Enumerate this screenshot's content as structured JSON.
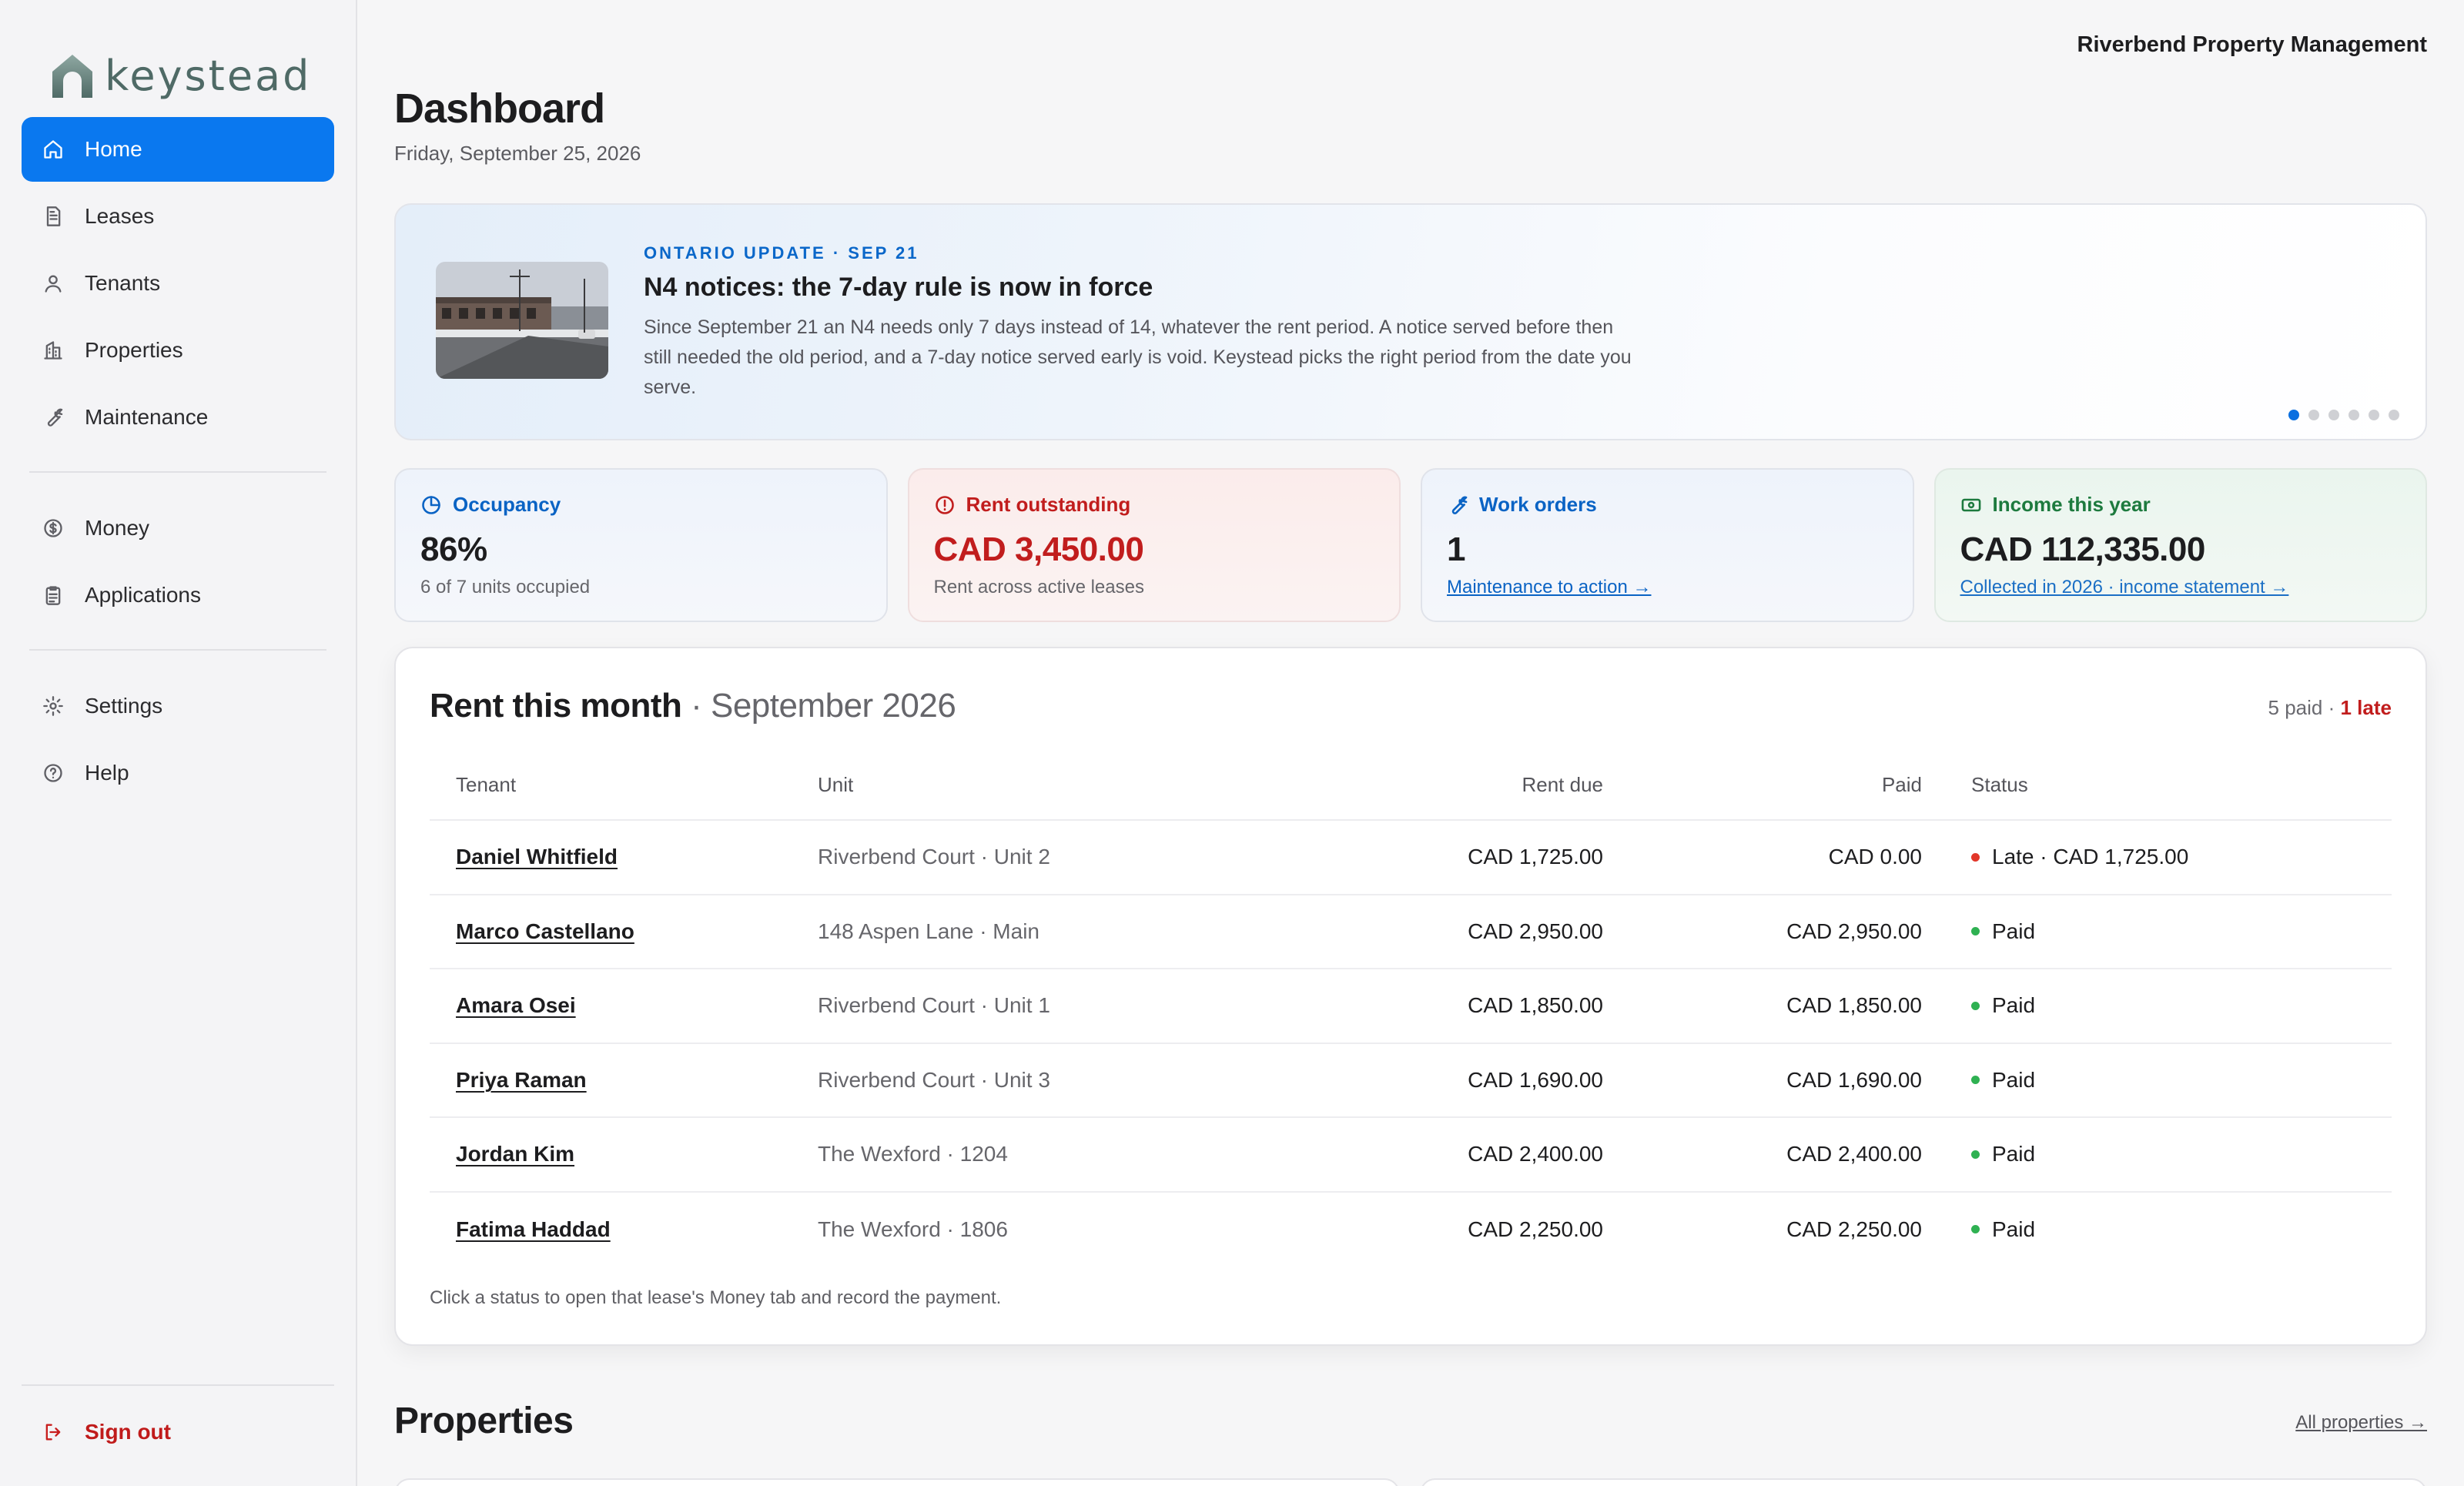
{
  "brand": {
    "name": "keystead",
    "color": "#4f6a66"
  },
  "colors": {
    "accent": "#0a78ef",
    "danger": "#c11d1d",
    "success": "#2fb152"
  },
  "sidebar": {
    "primary": [
      {
        "label": "Home",
        "icon": "home-icon"
      },
      {
        "label": "Leases",
        "icon": "document-icon"
      },
      {
        "label": "Tenants",
        "icon": "user-icon"
      },
      {
        "label": "Properties",
        "icon": "building-icon"
      },
      {
        "label": "Maintenance",
        "icon": "wrench-icon"
      }
    ],
    "secondary": [
      {
        "label": "Money",
        "icon": "dollar-icon"
      },
      {
        "label": "Applications",
        "icon": "clipboard-icon"
      }
    ],
    "tertiary": [
      {
        "label": "Settings",
        "icon": "gear-icon"
      },
      {
        "label": "Help",
        "icon": "help-icon"
      }
    ],
    "sign_out": "Sign out"
  },
  "header": {
    "org": "Riverbend Property Management",
    "title": "Dashboard",
    "date": "Friday, September 25, 2026"
  },
  "banner": {
    "kicker": "ONTARIO UPDATE · SEP 21",
    "headline": "N4 notices: the 7-day rule is now in force",
    "body": "Since September 21 an N4 needs only 7 days instead of 14, whatever the rent period. A notice served before then still needed the old period, and a 7-day notice served early is void. Keystead picks the right period from the date you serve.",
    "slides": 6,
    "active_slide": 1
  },
  "stats": {
    "occupancy": {
      "label": "Occupancy",
      "value": "86%",
      "sub": "6 of 7 units occupied"
    },
    "rent_outstanding": {
      "label": "Rent outstanding",
      "value": "CAD 3,450.00",
      "sub": "Rent across active leases"
    },
    "work_orders": {
      "label": "Work orders",
      "value": "1",
      "link": "Maintenance to action →"
    },
    "income": {
      "label": "Income this year",
      "value": "CAD 112,335.00",
      "link": "Collected in 2026 · income statement →"
    }
  },
  "rent": {
    "title": "Rent this month",
    "period": "· September 2026",
    "paid_summary": "5 paid ·",
    "late_summary": "1 late",
    "columns": {
      "tenant": "Tenant",
      "unit": "Unit",
      "due": "Rent due",
      "paid": "Paid",
      "status": "Status"
    },
    "rows": [
      {
        "tenant": "Daniel Whitfield",
        "unit": "Riverbend Court · Unit 2",
        "due": "CAD 1,725.00",
        "paid": "CAD 0.00",
        "status": "Late · CAD 1,725.00",
        "state": "late"
      },
      {
        "tenant": "Marco Castellano",
        "unit": "148 Aspen Lane · Main",
        "due": "CAD 2,950.00",
        "paid": "CAD 2,950.00",
        "status": "Paid",
        "state": "paid"
      },
      {
        "tenant": "Amara Osei",
        "unit": "Riverbend Court · Unit 1",
        "due": "CAD 1,850.00",
        "paid": "CAD 1,850.00",
        "status": "Paid",
        "state": "paid"
      },
      {
        "tenant": "Priya Raman",
        "unit": "Riverbend Court · Unit 3",
        "due": "CAD 1,690.00",
        "paid": "CAD 1,690.00",
        "status": "Paid",
        "state": "paid"
      },
      {
        "tenant": "Jordan Kim",
        "unit": "The Wexford · 1204",
        "due": "CAD 2,400.00",
        "paid": "CAD 2,400.00",
        "status": "Paid",
        "state": "paid"
      },
      {
        "tenant": "Fatima Haddad",
        "unit": "The Wexford · 1806",
        "due": "CAD 2,250.00",
        "paid": "CAD 2,250.00",
        "status": "Paid",
        "state": "paid"
      }
    ],
    "hint": "Click a status to open that lease's Money tab and record the payment."
  },
  "properties": {
    "title": "Properties",
    "link": "All properties →"
  }
}
